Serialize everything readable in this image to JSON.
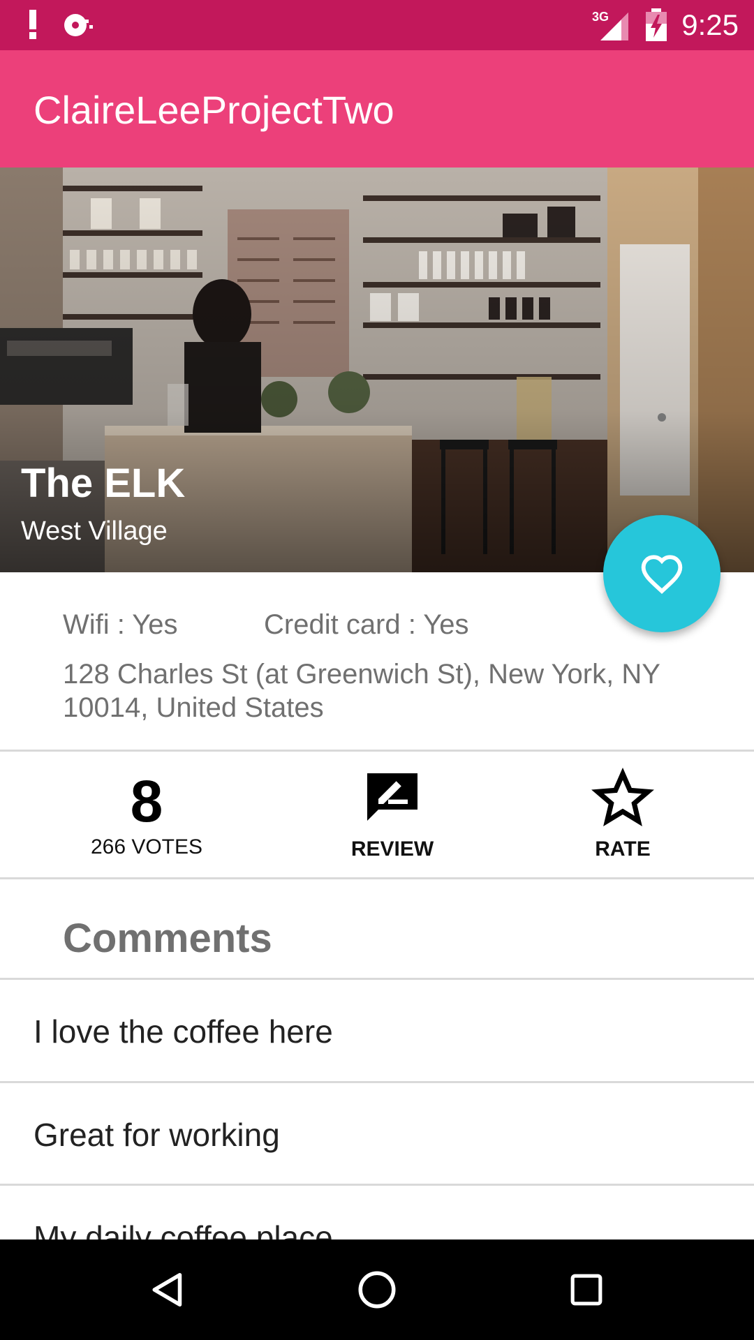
{
  "status_bar": {
    "time": "9:25",
    "network": "3G",
    "icons": [
      "alert-icon",
      "sync-icon",
      "signal-icon",
      "battery-charging-icon"
    ]
  },
  "app_bar": {
    "title": "ClaireLeeProjectTwo"
  },
  "hero": {
    "name": "The ELK",
    "area": "West Village"
  },
  "details": {
    "wifi": "Wifi : Yes",
    "credit_card": "Credit card : Yes",
    "address": "128 Charles St (at Greenwich St), New York, NY 10014, United States"
  },
  "actions": {
    "score": "8",
    "votes": "266 VOTES",
    "review_label": "REVIEW",
    "rate_label": "RATE"
  },
  "comments": {
    "header": "Comments",
    "items": [
      "I love the coffee here",
      "Great for working",
      "My daily coffee place"
    ]
  },
  "colors": {
    "status_bar": "#c2185b",
    "app_bar": "#ec407a",
    "fab": "#26c6da"
  }
}
